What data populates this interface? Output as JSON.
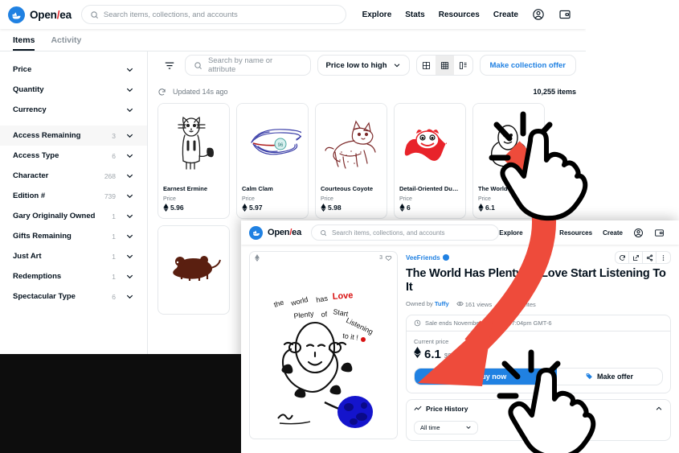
{
  "brand": {
    "name_part1": "Open",
    "name_part2": "ea",
    "bolt": "⚡"
  },
  "header": {
    "search_placeholder": "Search items, collections, and accounts",
    "nav": [
      {
        "label": "Explore"
      },
      {
        "label": "Stats"
      },
      {
        "label": "Resources"
      },
      {
        "label": "Create"
      }
    ],
    "account_icon": "account-circle-icon",
    "wallet_icon": "wallet-icon"
  },
  "collection_page": {
    "tabs": [
      {
        "label": "Items",
        "active": true
      },
      {
        "label": "Activity",
        "active": false
      }
    ],
    "filters": [
      {
        "label": "Price",
        "count": ""
      },
      {
        "label": "Quantity",
        "count": ""
      },
      {
        "label": "Currency",
        "count": ""
      },
      {
        "label": "Access Remaining",
        "count": "3",
        "highlight": true
      },
      {
        "label": "Access Type",
        "count": "6"
      },
      {
        "label": "Character",
        "count": "268"
      },
      {
        "label": "Edition #",
        "count": "739"
      },
      {
        "label": "Gary Originally Owned",
        "count": "1"
      },
      {
        "label": "Gifts Remaining",
        "count": "1"
      },
      {
        "label": "Just Art",
        "count": "1"
      },
      {
        "label": "Redemptions",
        "count": "1"
      },
      {
        "label": "Spectacular Type",
        "count": "6"
      }
    ],
    "toolbar": {
      "filter_icon": "filter-icon",
      "search_placeholder": "Search by name or attribute",
      "sort_value": "Price low to high",
      "view_modes": [
        {
          "name": "grid-large",
          "active": false
        },
        {
          "name": "grid-small",
          "active": true
        },
        {
          "name": "list-view",
          "active": false
        }
      ],
      "make_collection_offer": "Make collection offer"
    },
    "status": {
      "refresh_icon": "refresh-icon",
      "updated": "Updated 14s ago",
      "item_count": "10,255 items"
    },
    "price_label": "Price",
    "items": [
      {
        "name": "Earnest Ermine",
        "price": "5.96",
        "art": "ermine"
      },
      {
        "name": "Calm Clam",
        "price": "5.97",
        "art": "clam"
      },
      {
        "name": "Courteous Coyote",
        "price": "5.98",
        "art": "coyote"
      },
      {
        "name": "Detail-Oriented Dumbo O...",
        "price": "6",
        "art": "octopus"
      },
      {
        "name": "The World Ha...",
        "price": "6.1",
        "art": "world"
      }
    ],
    "items_row2": [
      {
        "name": "",
        "price": "",
        "art": "mouse"
      }
    ]
  },
  "item_detail": {
    "favorites_count": "3",
    "collection": "VeeFriends",
    "title": "The World Has Plenty Of Love Start Listening To It",
    "owner_prefix": "Owned by",
    "owner": "Tuffy",
    "views": "161 views",
    "favorites": "3 favorites",
    "actions": [
      {
        "name": "refresh-icon"
      },
      {
        "name": "external-link-icon"
      },
      {
        "name": "share-icon"
      },
      {
        "name": "more-options-icon"
      }
    ],
    "sale_ends": "Sale ends November 2, 2022 at 7:04pm GMT-6",
    "current_price_label": "Current price",
    "price_eth": "6.1",
    "price_usd": "$9,758",
    "buy_now": "Buy now",
    "make_offer": "Make offer",
    "price_history_title": "Price History",
    "time_filter": "All time"
  },
  "colors": {
    "accent_blue": "#2081E2",
    "text_dark": "#04111d",
    "text_muted": "#707a83",
    "border": "#e5e8eb",
    "annotation_red": "#EE4B3B"
  }
}
